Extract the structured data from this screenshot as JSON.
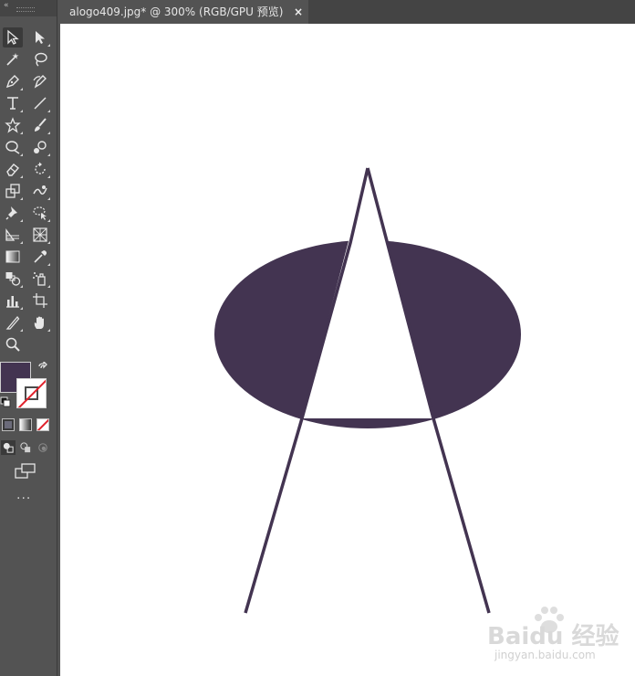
{
  "document_tab": {
    "title": "alogo409.jpg* @ 300% (RGB/GPU 预览)",
    "close_glyph": "×"
  },
  "toolbar": {
    "tools": [
      {
        "name": "selection-tool",
        "selected": true
      },
      {
        "name": "direct-selection-tool"
      },
      {
        "name": "magic-wand-tool"
      },
      {
        "name": "lasso-tool"
      },
      {
        "name": "pen-tool"
      },
      {
        "name": "curvature-tool"
      },
      {
        "name": "type-tool",
        "glyph": "T"
      },
      {
        "name": "line-segment-tool"
      },
      {
        "name": "star-tool"
      },
      {
        "name": "paintbrush-tool"
      },
      {
        "name": "shaper-tool"
      },
      {
        "name": "blob-brush-tool"
      },
      {
        "name": "eraser-tool"
      },
      {
        "name": "rotate-tool"
      },
      {
        "name": "scale-tool"
      },
      {
        "name": "warp-tool"
      },
      {
        "name": "puppet-warp-tool"
      },
      {
        "name": "free-transform-tool"
      },
      {
        "name": "shape-builder-tool"
      },
      {
        "name": "perspective-grid-tool"
      },
      {
        "name": "gradient-tool"
      },
      {
        "name": "eyedropper-tool"
      },
      {
        "name": "blend-tool"
      },
      {
        "name": "symbol-sprayer-tool"
      },
      {
        "name": "column-graph-tool"
      },
      {
        "name": "artboard-tool"
      },
      {
        "name": "slice-tool"
      },
      {
        "name": "hand-tool"
      },
      {
        "name": "zoom-tool"
      }
    ],
    "more_label": "..."
  },
  "colors": {
    "fill": "#433451",
    "stroke": "none",
    "accent_red": "#e0202a"
  },
  "artwork": {
    "shape_color": "#433451",
    "description_icon": "compass-like triangle over ellipse"
  },
  "watermark": {
    "brand": "Baidu 经验",
    "site": "jingyan.baidu.com"
  }
}
